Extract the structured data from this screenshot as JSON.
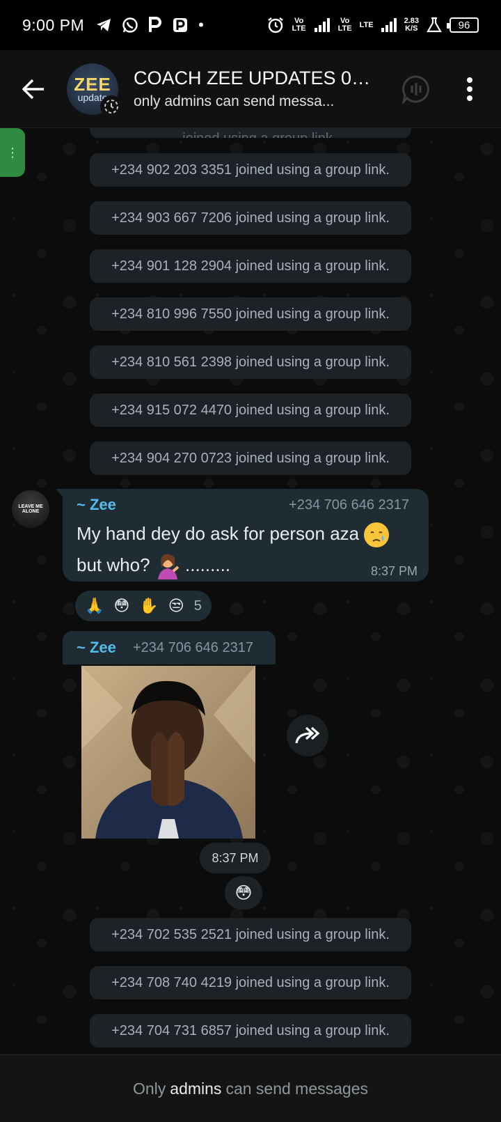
{
  "status_bar": {
    "time": "9:00 PM",
    "left_icons": [
      "telegram-icon",
      "whatsapp-icon",
      "p-icon",
      "p-outline-icon",
      "dot-icon"
    ],
    "network_labels": [
      "Vo LTE",
      "Vo LTE",
      "LTE"
    ],
    "speed": "2.83",
    "speed_unit": "K/S",
    "battery": "96"
  },
  "header": {
    "title": "COACH ZEE UPDATES 00...",
    "subtitle": "only admins can send messa...",
    "avatar_text_line1": "ZEE",
    "avatar_text_line2": "update"
  },
  "system_messages_top": [
    "+234 902 203 3351 joined using a group link.",
    "+234 903 667 7206 joined using a group link.",
    "+234 901 128 2904 joined using a group link.",
    "+234 810 996 7550 joined using a group link.",
    "+234 810 561 2398 joined using a group link.",
    "+234 915 072 4470 joined using a group link.",
    "+234 904 270 0723 joined using a group link."
  ],
  "message": {
    "avatar_text": "LEAVE ME ALONE",
    "sender": "~ Zee",
    "sender_number": "+234 706 646 2317",
    "text_line1": "My hand dey do ask for person aza",
    "text_line2": "but who?",
    "text_trailing": ".........",
    "time": "8:37 PM",
    "reactions": [
      "🙏",
      "😳",
      "✋",
      "😒"
    ],
    "reaction_count": "5"
  },
  "photo_message": {
    "sender": "~ Zee",
    "sender_number": "+234 706 646 2317",
    "time": "8:37 PM",
    "reaction": "😳"
  },
  "system_messages_bottom": [
    "+234 702 535 2521 joined using a group link.",
    "+234 708 740 4219 joined using a group link.",
    "+234 704 731 6857 joined using a group link."
  ],
  "footer": {
    "prefix": "Only",
    "emphasis": "admins",
    "suffix": "can send messages"
  }
}
